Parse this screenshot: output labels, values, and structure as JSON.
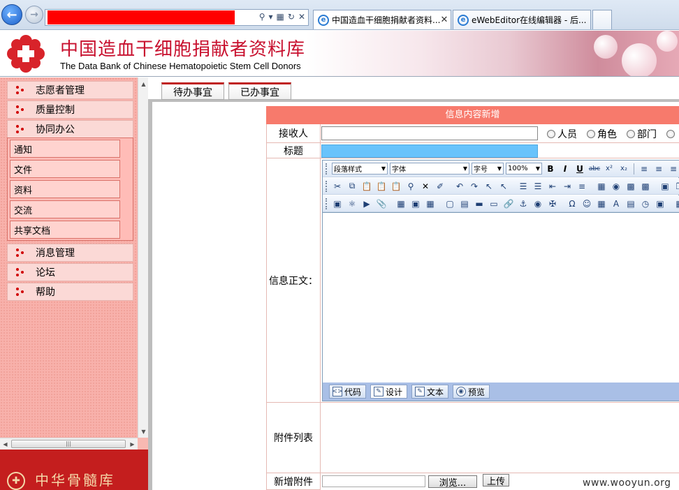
{
  "browser": {
    "address_value": "",
    "tabs": [
      {
        "label": "中国造血干细胞捐献者资料..."
      },
      {
        "label": "eWebEditor在线编辑器 - 后..."
      }
    ],
    "close_glyph": "✕"
  },
  "site": {
    "title": "中国造血干细胞捐献者资料库",
    "subtitle": "The Data Bank of Chinese Hematopoietic Stem Cell Donors"
  },
  "sidebar": {
    "items_top": [
      {
        "label": "志愿者管理"
      },
      {
        "label": "质量控制"
      },
      {
        "label": "协同办公"
      }
    ],
    "sub_items": [
      {
        "label": "通知"
      },
      {
        "label": "文件"
      },
      {
        "label": "资料"
      },
      {
        "label": "交流"
      },
      {
        "label": "共享文档"
      }
    ],
    "items_bottom": [
      {
        "label": "消息管理"
      },
      {
        "label": "论坛"
      },
      {
        "label": "帮助"
      }
    ],
    "footer_text": "中华骨髓库"
  },
  "content": {
    "tabs": [
      {
        "label": "待办事宜"
      },
      {
        "label": "已办事宜"
      }
    ],
    "form": {
      "header": "信息内容新增",
      "recipient_label": "接收人",
      "recipient_value": "",
      "radio_options": [
        {
          "label": "人员"
        },
        {
          "label": "角色"
        },
        {
          "label": "部门"
        },
        {
          "label": ""
        }
      ],
      "title_label": "标题",
      "title_value": "",
      "body_label": "信息正文：",
      "attachments_label": "附件列表",
      "add_attachment_label": "新增附件",
      "browse_label": "浏览...",
      "upload_label": "上传"
    },
    "editor": {
      "style_select": "段落样式",
      "font_select": "字体",
      "size_select": "字号",
      "zoom_select": "100%",
      "modes": [
        {
          "label": "代码"
        },
        {
          "label": "设计"
        },
        {
          "label": "文本"
        },
        {
          "label": "预览"
        }
      ]
    }
  },
  "watermark": "www.wooyun.org",
  "colors": {
    "brand_red": "#c8102e",
    "form_header": "#f77a6c",
    "title_input": "#69c3fb",
    "sidebar_bg": "#f8b1ab"
  }
}
